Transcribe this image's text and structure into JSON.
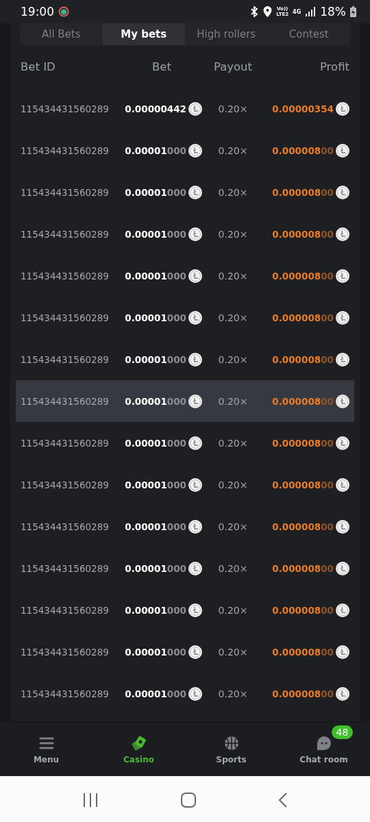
{
  "status_bar": {
    "time": "19:00",
    "network": "Vo))\nLTE2",
    "net_type": "4G",
    "battery": "18%"
  },
  "tabs": [
    {
      "label": "All Bets",
      "selected": false
    },
    {
      "label": "My bets",
      "selected": true
    },
    {
      "label": "High rollers",
      "selected": false
    },
    {
      "label": "Contest",
      "selected": false
    }
  ],
  "table": {
    "columns": [
      "Bet ID",
      "Bet",
      "Payout",
      "Profit"
    ],
    "rows": [
      {
        "id": "115434431560289",
        "bet": "0.00000442",
        "bet_dim": "",
        "payout": "0.20×",
        "profit": "0.00000354",
        "profit_dim": "",
        "highlighted": false
      },
      {
        "id": "115434431560289",
        "bet": "0.00001",
        "bet_dim": "000",
        "payout": "0.20×",
        "profit": "0.000008",
        "profit_dim": "00",
        "highlighted": false
      },
      {
        "id": "115434431560289",
        "bet": "0.00001",
        "bet_dim": "000",
        "payout": "0.20×",
        "profit": "0.000008",
        "profit_dim": "00",
        "highlighted": false
      },
      {
        "id": "115434431560289",
        "bet": "0.00001",
        "bet_dim": "000",
        "payout": "0.20×",
        "profit": "0.000008",
        "profit_dim": "00",
        "highlighted": false
      },
      {
        "id": "115434431560289",
        "bet": "0.00001",
        "bet_dim": "000",
        "payout": "0.20×",
        "profit": "0.000008",
        "profit_dim": "00",
        "highlighted": false
      },
      {
        "id": "115434431560289",
        "bet": "0.00001",
        "bet_dim": "000",
        "payout": "0.20×",
        "profit": "0.000008",
        "profit_dim": "00",
        "highlighted": false
      },
      {
        "id": "115434431560289",
        "bet": "0.00001",
        "bet_dim": "000",
        "payout": "0.20×",
        "profit": "0.000008",
        "profit_dim": "00",
        "highlighted": false
      },
      {
        "id": "115434431560289",
        "bet": "0.00001",
        "bet_dim": "000",
        "payout": "0.20×",
        "profit": "0.000008",
        "profit_dim": "00",
        "highlighted": true
      },
      {
        "id": "115434431560289",
        "bet": "0.00001",
        "bet_dim": "000",
        "payout": "0.20×",
        "profit": "0.000008",
        "profit_dim": "00",
        "highlighted": false
      },
      {
        "id": "115434431560289",
        "bet": "0.00001",
        "bet_dim": "000",
        "payout": "0.20×",
        "profit": "0.000008",
        "profit_dim": "00",
        "highlighted": false
      },
      {
        "id": "115434431560289",
        "bet": "0.00001",
        "bet_dim": "000",
        "payout": "0.20×",
        "profit": "0.000008",
        "profit_dim": "00",
        "highlighted": false
      },
      {
        "id": "115434431560289",
        "bet": "0.00001",
        "bet_dim": "000",
        "payout": "0.20×",
        "profit": "0.000008",
        "profit_dim": "00",
        "highlighted": false
      },
      {
        "id": "115434431560289",
        "bet": "0.00001",
        "bet_dim": "000",
        "payout": "0.20×",
        "profit": "0.000008",
        "profit_dim": "00",
        "highlighted": false
      },
      {
        "id": "115434431560289",
        "bet": "0.00001",
        "bet_dim": "000",
        "payout": "0.20×",
        "profit": "0.000008",
        "profit_dim": "00",
        "highlighted": false
      },
      {
        "id": "115434431560289",
        "bet": "0.00001",
        "bet_dim": "000",
        "payout": "0.20×",
        "profit": "0.000008",
        "profit_dim": "00",
        "highlighted": false
      }
    ]
  },
  "bottom_nav": [
    {
      "label": "Menu",
      "kind": "menu",
      "selected": false
    },
    {
      "label": "Casino",
      "kind": "casino",
      "selected": true
    },
    {
      "label": "Sports",
      "kind": "sports",
      "selected": false
    },
    {
      "label": "Chat room",
      "kind": "chat",
      "selected": false,
      "badge": "48"
    }
  ]
}
